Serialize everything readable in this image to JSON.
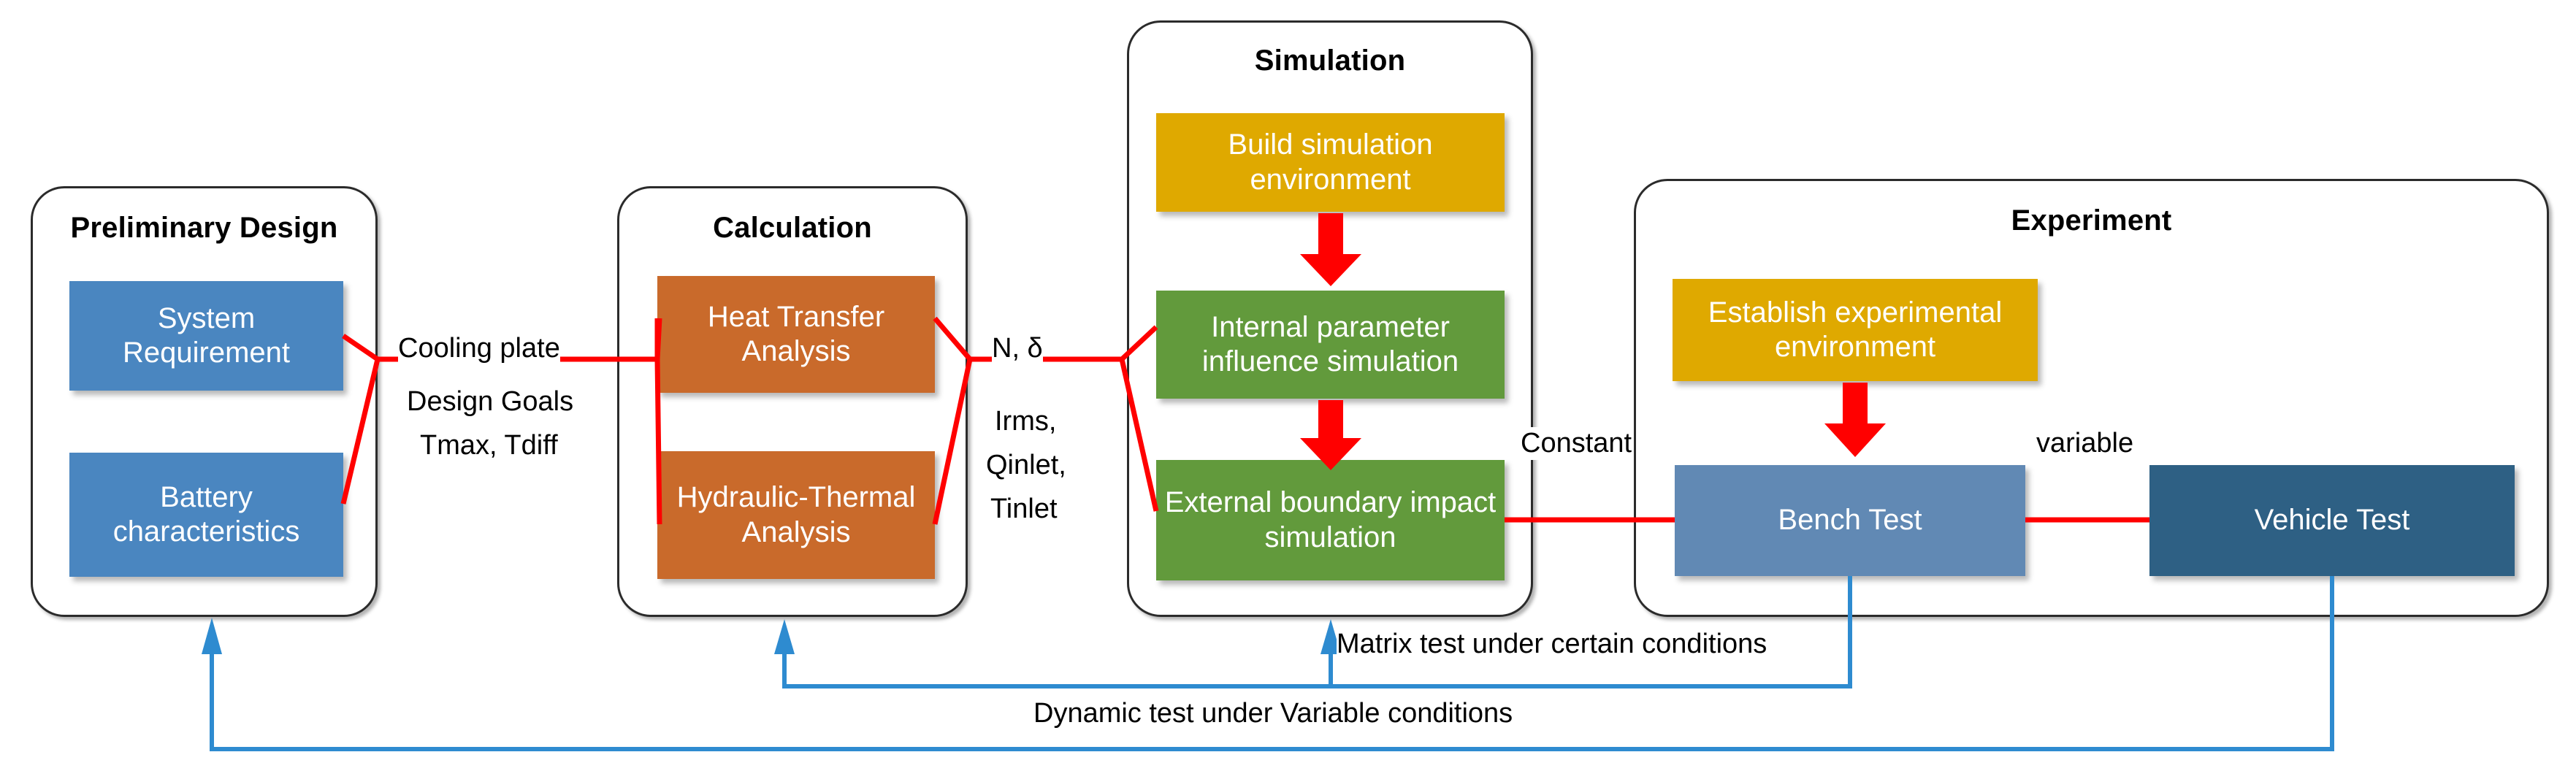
{
  "diagram": {
    "title_not_shown": "",
    "groups": [
      {
        "id": "preliminary-design",
        "label": "Preliminary Design"
      },
      {
        "id": "calculation",
        "label": "Calculation"
      },
      {
        "id": "simulation",
        "label": "Simulation"
      },
      {
        "id": "experiment",
        "label": "Experiment"
      }
    ],
    "nodes": {
      "system_requirement": "System Requirement",
      "battery_characteristics": "Battery characteristics",
      "heat_transfer_analysis": "Heat Transfer Analysis",
      "hydraulic_thermal_analysis": "Hydraulic-Thermal Analysis",
      "build_simulation_environment": "Build simulation environment",
      "internal_parameter_simulation": "Internal parameter influence simulation",
      "external_boundary_simulation": "External boundary impact simulation",
      "establish_experimental_environment": "Establish experimental environment",
      "bench_test": "Bench Test",
      "vehicle_test": "Vehicle Test"
    },
    "edge_labels": {
      "cooling_plate": "Cooling plate",
      "design_goals": "Design Goals",
      "design_goals_params": "Tmax, Tdiff",
      "n_delta": "N,  δ",
      "irms": "Irms,",
      "qinlet": "Qinlet,",
      "tinlet": "Tinlet",
      "constant": "Constant",
      "variable": "variable",
      "matrix_test": "Matrix test under certain conditions",
      "dynamic_test": "Dynamic test under Variable conditions"
    },
    "colors": {
      "blue": "#4a86c0",
      "orange": "#c96a2b",
      "green": "#629a3c",
      "yellow": "#dfa900",
      "steel_blue": "#6189b4",
      "dark_blue": "#2e6084",
      "connector_red": "#ff0000",
      "feedback_blue": "#2e8bd0",
      "group_border": "#2b2b2b"
    }
  }
}
